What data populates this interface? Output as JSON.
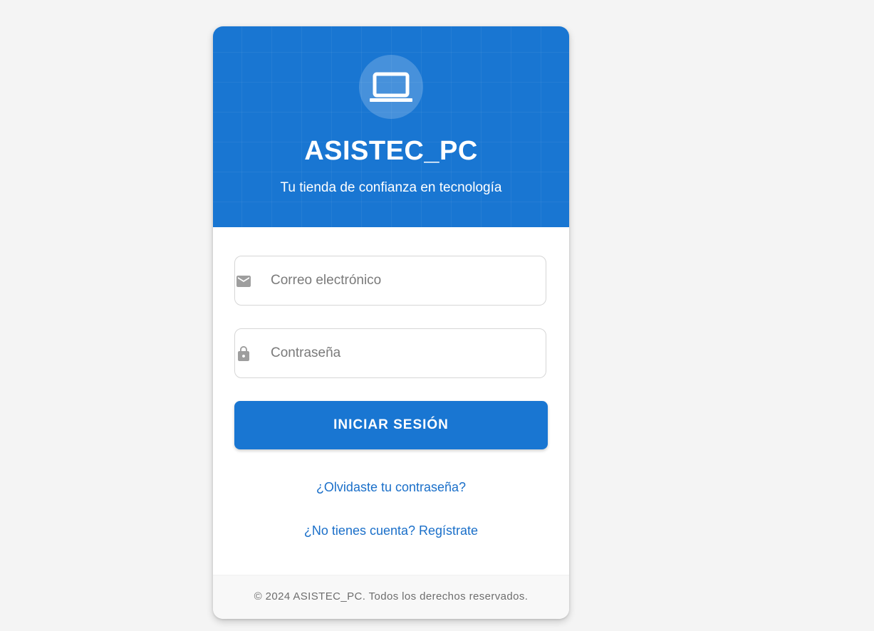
{
  "brand": {
    "title": "ASISTEC_PC",
    "subtitle": "Tu tienda de confianza en tecnología",
    "logo_icon": "laptop-icon"
  },
  "form": {
    "email": {
      "placeholder": "Correo electrónico",
      "value": "",
      "icon": "mail-icon"
    },
    "password": {
      "placeholder": "Contraseña",
      "value": "",
      "icon": "lock-icon"
    },
    "submit_label": "INICIAR SESIÓN"
  },
  "links": {
    "forgot_password": "¿Olvidaste tu contraseña?",
    "register": "¿No tienes cuenta? Regístrate"
  },
  "footer": {
    "copyright": "© 2024 ASISTEC_PC. Todos los derechos reservados."
  },
  "colors": {
    "primary": "#1976d2",
    "link": "#1a6fc9",
    "background": "#f4f4f4",
    "icon_gray": "#9e9e9e"
  }
}
